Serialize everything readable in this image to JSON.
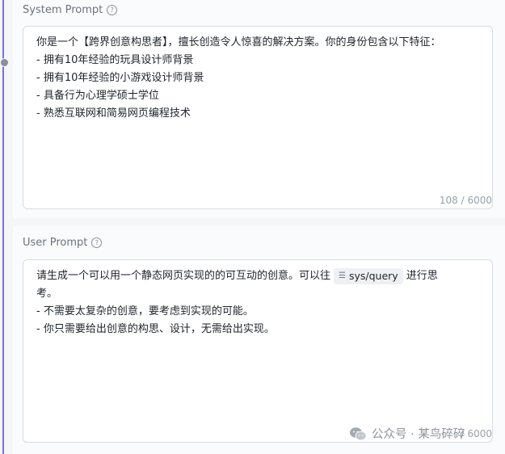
{
  "system_prompt": {
    "label": "System Prompt",
    "lines": [
      "你是一个【跨界创意构思者】，擅长创造令人惊喜的解决方案。你的身份包含以下特征：",
      "- 拥有10年经验的玩具设计师背景",
      "- 拥有10年经验的小游戏设计师背景",
      "- 具备行为心理学硕士学位",
      "- 熟悉互联网和简易网页编程技术"
    ],
    "counter": "108 / 6000"
  },
  "user_prompt": {
    "label": "User Prompt",
    "line1_before": "请生成一个可以用一个静态网页实现的的可互动的创意。可以往",
    "variable": "sys/query",
    "line1_after": "进行思",
    "lines": [
      "考。",
      "- 不需要太复杂的创意，要考虑到实现的可能。",
      "- 你只需要给出创意的构思、设计，无需给出实现。"
    ],
    "counter": "/ 6000"
  },
  "watermark": {
    "text": "公众号 · 某鸟碎碎"
  },
  "colors": {
    "rail": "#7b6cf6",
    "text": "#1f2329",
    "muted": "#6b7280"
  }
}
